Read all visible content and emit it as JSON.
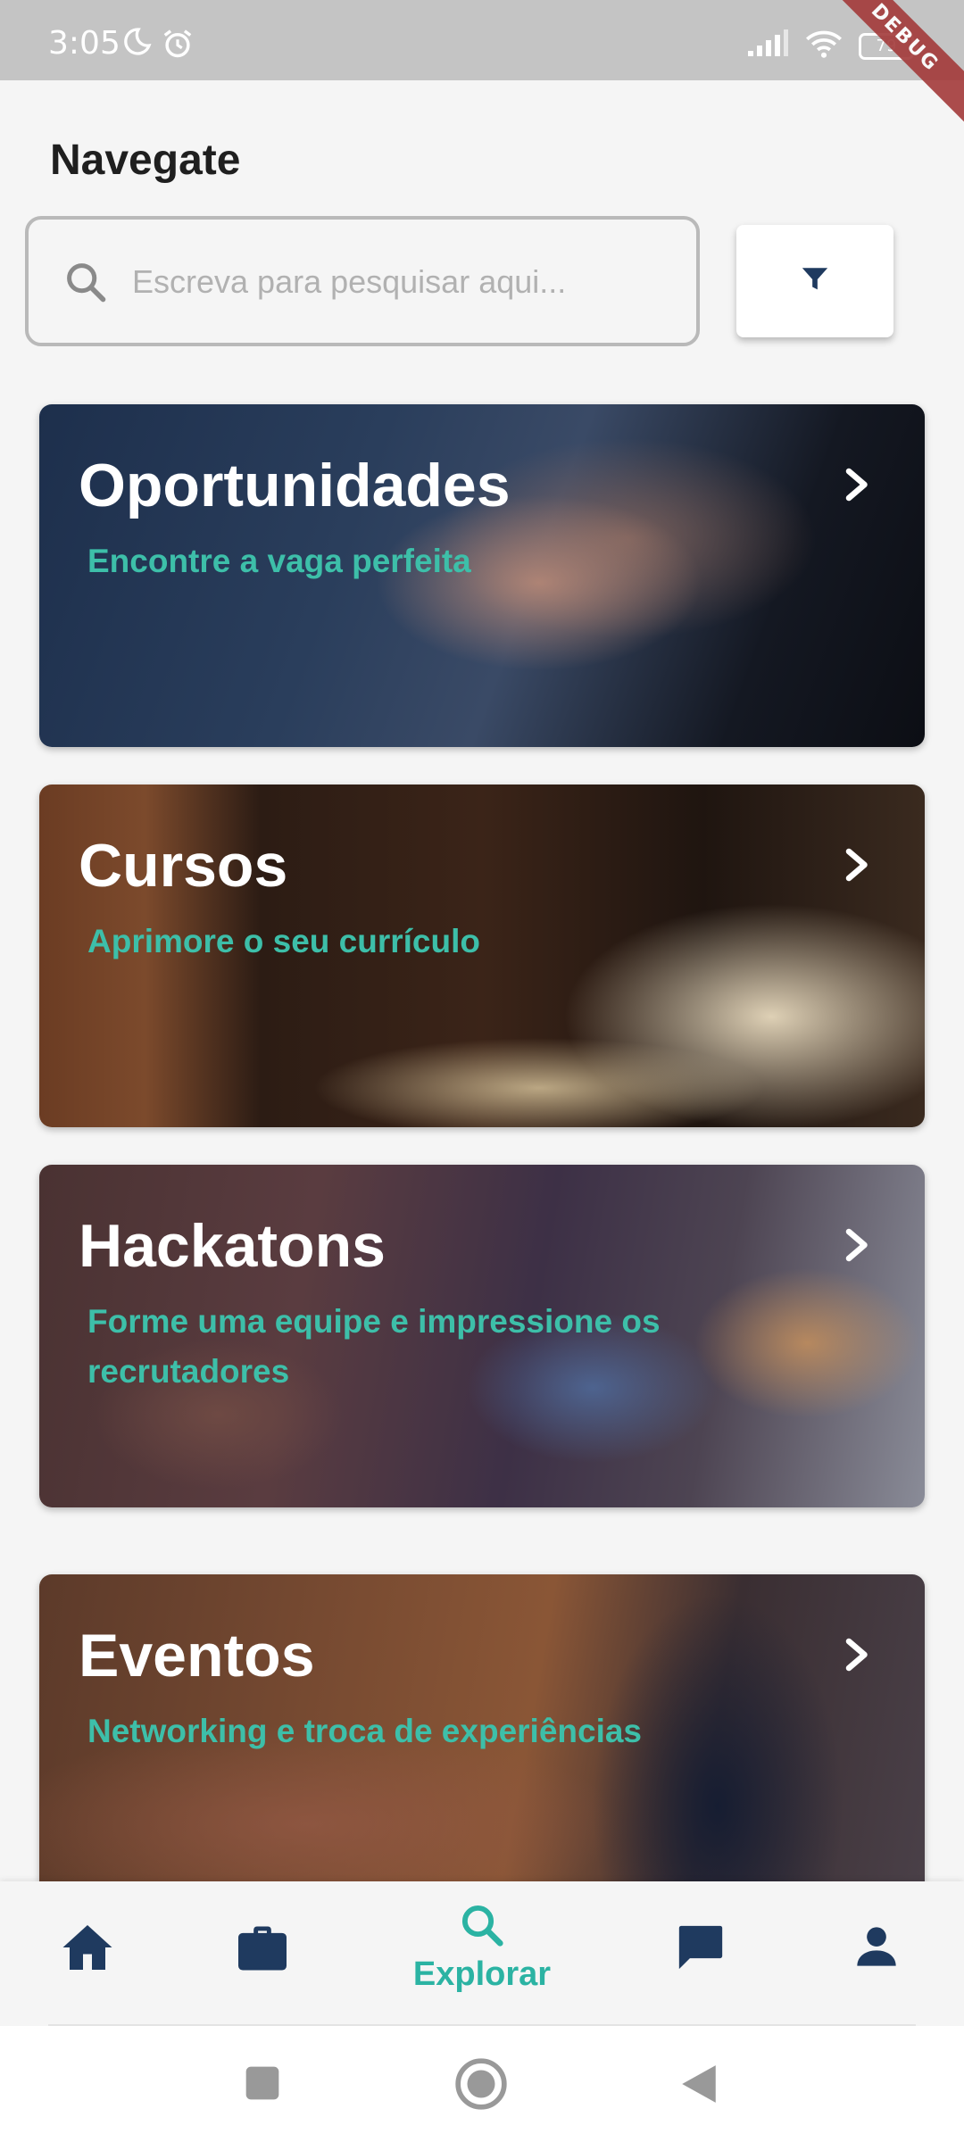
{
  "status_bar": {
    "time": "3:05",
    "battery": "79",
    "debug_label": "DEBUG"
  },
  "header": {
    "title": "Navegate"
  },
  "search": {
    "placeholder": "Escreva para pesquisar aqui...",
    "value": ""
  },
  "cards": [
    {
      "title": "Oportunidades",
      "subtitle": "Encontre a vaga perfeita"
    },
    {
      "title": "Cursos",
      "subtitle": "Aprimore o seu currículo"
    },
    {
      "title": "Hackatons",
      "subtitle": "Forme uma equipe e impressione os recrutadores"
    },
    {
      "title": "Eventos",
      "subtitle": "Networking e troca de experiências"
    }
  ],
  "bottom_nav": {
    "items": [
      {
        "icon": "home-icon"
      },
      {
        "icon": "briefcase-icon"
      },
      {
        "icon": "search-icon",
        "label": "Explorar",
        "active": true
      },
      {
        "icon": "chat-icon"
      },
      {
        "icon": "person-icon"
      }
    ]
  },
  "colors": {
    "accent": "#2bb3a3",
    "subtitle": "#3dbfa9",
    "nav_icon": "#1f3a5f",
    "status_bar": "#c4c4c4"
  }
}
